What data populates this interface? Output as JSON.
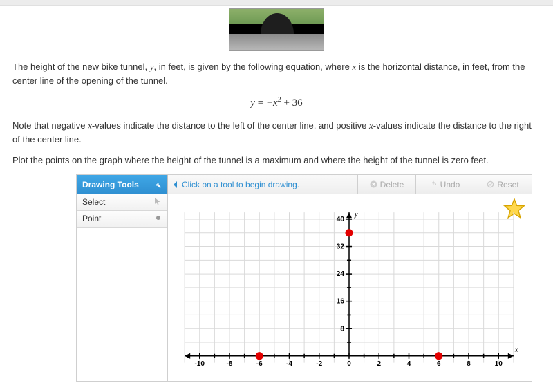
{
  "problem": {
    "intro1": "The height of the new bike tunnel, ",
    "var_y": "y",
    "intro2": ", in feet, is given by the following equation, where ",
    "var_x": "x",
    "intro3": " is the horizontal distance, in feet, from the center line of the opening of the tunnel.",
    "equation_lhs": "y",
    "equation_eq": " = ",
    "equation_rhs1": "−x",
    "equation_exp": "2",
    "equation_rhs2": " + 36",
    "note1": "Note that negative ",
    "note2": "-values indicate the distance to the left of the center line, and positive ",
    "note3": "-values indicate the distance to the right of the center line.",
    "task": "Plot the points on the graph where the height of the tunnel is a maximum and where the height of the tunnel is zero feet."
  },
  "toolbar": {
    "drawing_tools": "Drawing Tools",
    "hint": "Click on a tool to begin drawing.",
    "delete": "Delete",
    "undo": "Undo",
    "reset": "Reset"
  },
  "tools": {
    "select": "Select",
    "point": "Point"
  },
  "chart_data": {
    "type": "scatter",
    "xlabel": "x",
    "ylabel": "y",
    "xlim": [
      -11,
      11
    ],
    "ylim": [
      -2,
      42
    ],
    "xticks": [
      -10,
      -8,
      -6,
      -4,
      -2,
      0,
      2,
      4,
      6,
      8,
      10
    ],
    "yticks": [
      8,
      16,
      24,
      32,
      40
    ],
    "points": [
      {
        "x": -6,
        "y": 0
      },
      {
        "x": 6,
        "y": 0
      },
      {
        "x": 0,
        "y": 36
      }
    ]
  }
}
